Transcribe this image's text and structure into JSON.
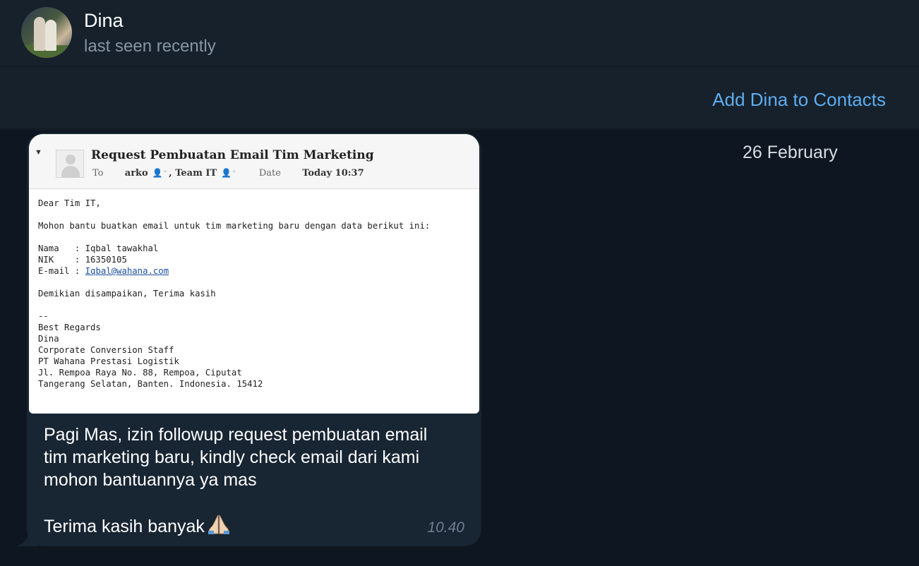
{
  "header": {
    "name": "Dina",
    "status": "last seen recently"
  },
  "contact_bar": {
    "add_label": "Add Dina to Contacts"
  },
  "chat": {
    "date_label": "26 February",
    "message": {
      "text_line1": "Pagi Mas, izin followup request pembuatan email tim marketing baru, kindly check email dari kami mohon bantuannya ya mas",
      "text_line2": "Terima kasih banyak",
      "emoji": "folded-hands",
      "time": "10.40"
    },
    "attachment": {
      "subject": "Request Pembuatan Email Tim Marketing",
      "to_label": "To",
      "to_1": "arko",
      "to_2": ", Team IT",
      "date_label": "Date",
      "date_value": "Today 10:37",
      "body": {
        "greeting": "Dear Tim IT,",
        "request": "Mohon bantu buatkan email untuk tim marketing baru dengan data berikut ini:",
        "nama": "Nama   : Iqbal tawakhal",
        "nik": "NIK    : 16350105",
        "email_prefix": "E-mail : ",
        "email_link": "Iqbal@wahana.com",
        "closing": "Demikian disampaikan, Terima kasih",
        "sep": "--",
        "sig_1": "Best Regards",
        "sig_2": "Dina",
        "sig_3": "Corporate Conversion Staff",
        "sig_4": "PT Wahana Prestasi Logistik",
        "sig_5": "Jl. Rempoa Raya No. 88, Rempoa, Ciputat",
        "sig_6": "Tangerang Selatan, Banten. Indonesia. 15412"
      }
    }
  },
  "colors": {
    "header_bg": "#17212b",
    "chat_bg": "#0e1621",
    "bubble_bg": "#182533",
    "accent": "#5eadf0",
    "muted": "#8696a4"
  }
}
